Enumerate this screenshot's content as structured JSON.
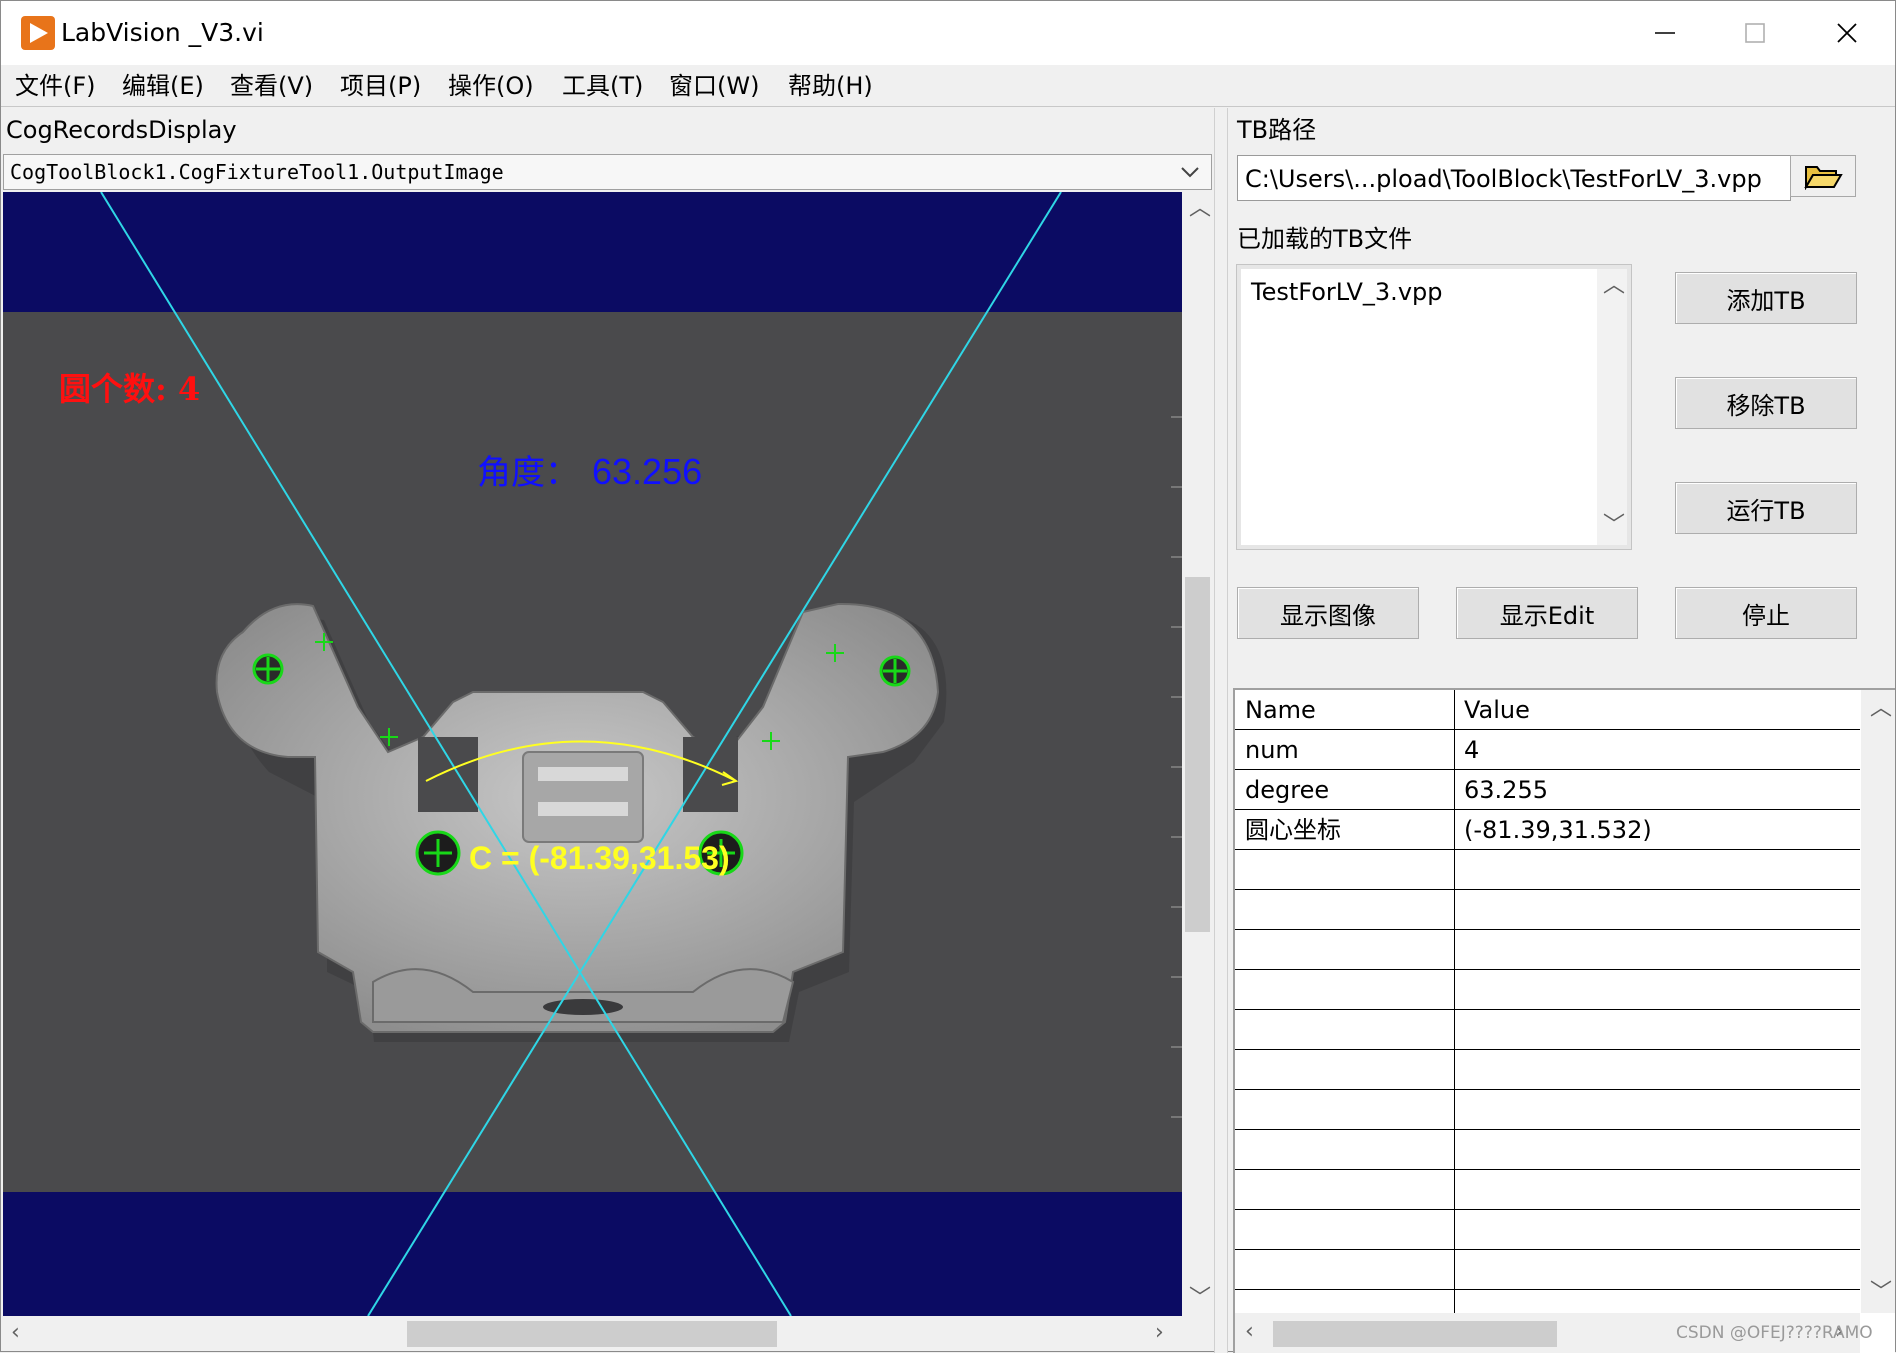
{
  "window": {
    "title": "LabVision _V3.vi",
    "controls": [
      "─",
      "☐",
      "✕"
    ]
  },
  "menu": [
    "文件(F)",
    "编辑(E)",
    "查看(V)",
    "项目(P)",
    "操作(O)",
    "工具(T)",
    "窗口(W)",
    "帮助(H)"
  ],
  "display": {
    "label": "CogRecordsDisplay",
    "selected_image": "CogToolBlock1.CogFixtureTool1.OutputImage",
    "overlay": {
      "circle_count_text": "圆个数: 4",
      "angle_label": "角度：",
      "angle_value": "63.256",
      "center_text": "C = (-81.39,31.53)"
    },
    "colors": {
      "background": "#0b0b63",
      "camera_field": "#4a4a4c",
      "line": "#2fd6e6",
      "marker": "#18d818",
      "arc": "#ffff22",
      "count_text": "#ff1010",
      "angle_text": "#1010ff"
    }
  },
  "tb_panel": {
    "path_label": "TB路径",
    "path_value": "C:\\Users\\...pload\\ToolBlock\\TestForLV_3.vpp",
    "browse_icon": "folder-open-icon",
    "loaded_label": "已加载的TB文件",
    "loaded_files": [
      "TestForLV_3.vpp"
    ],
    "buttons": {
      "add": "添加TB",
      "remove": "移除TB",
      "run": "运行TB",
      "show_image": "显示图像",
      "show_edit": "显示Edit",
      "stop": "停止"
    }
  },
  "results_table": {
    "headers": [
      "Name",
      "Value"
    ],
    "rows": [
      [
        "num",
        "4"
      ],
      [
        "degree",
        "63.255"
      ],
      [
        "圆心坐标",
        "(-81.39,31.532)"
      ]
    ]
  },
  "watermark": "CSDN @OFEJ????RAMO"
}
